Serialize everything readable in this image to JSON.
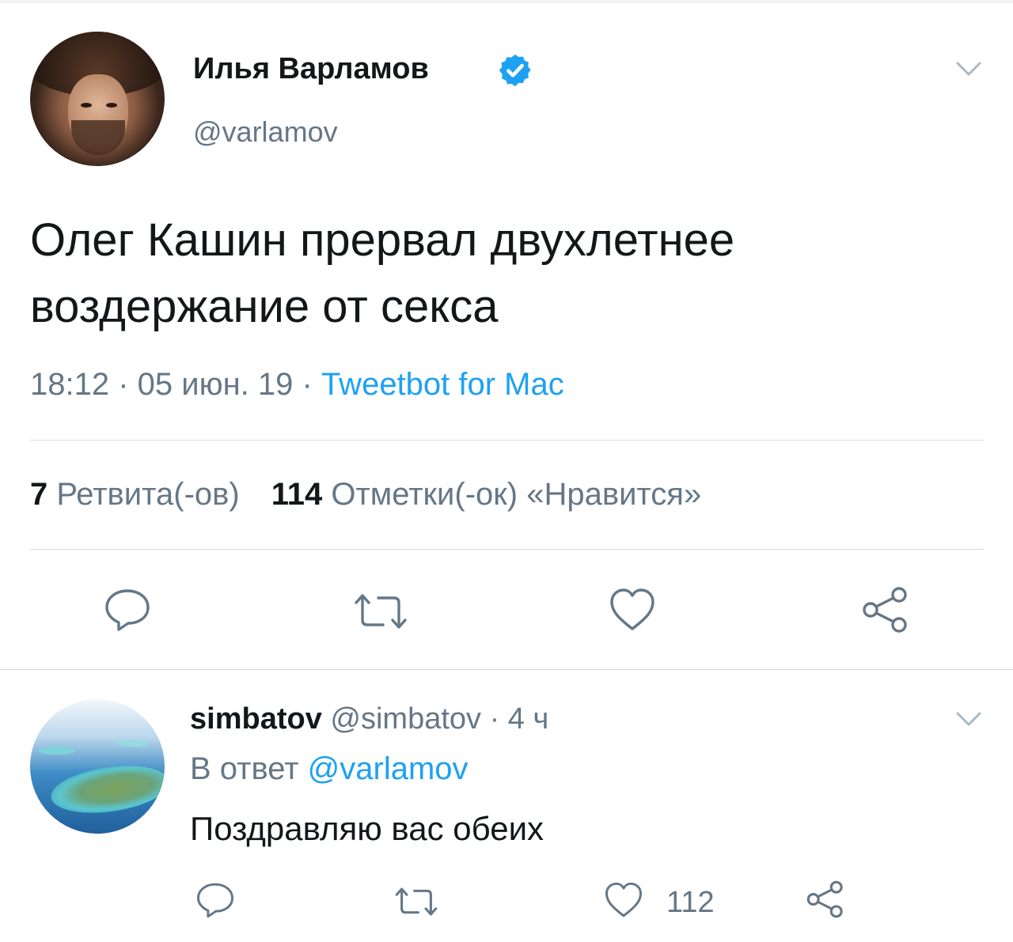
{
  "tweet": {
    "author": {
      "name": "Илья Варламов",
      "handle": "@varlamov",
      "verified": true
    },
    "text": "Олег Кашин прервал двухлетнее воздержание от секса",
    "timestamp": "18:12 · 05 июн. 19 · ",
    "source": "Tweetbot for Mac",
    "stats": {
      "retweets_count": "7",
      "retweets_label": "Ретвита(-ов)",
      "likes_count": "114",
      "likes_label": "Отметки(-ок) «Нравится»"
    },
    "icons": [
      "reply-icon",
      "retweet-icon",
      "like-icon",
      "share-icon",
      "chevron-down-icon",
      "verified-badge-icon"
    ]
  },
  "reply": {
    "author": {
      "name": "simbatov",
      "handle": "@simbatov",
      "time": " · 4 ч"
    },
    "in_reply_to_label": "В ответ ",
    "in_reply_to_handle": "@varlamov",
    "text": "Поздравляю вас обеих",
    "likes": "112"
  },
  "colors": {
    "accent": "#1da1f2",
    "secondary_text": "#657786",
    "primary_text": "#14171a",
    "divider": "#d6dde3"
  }
}
